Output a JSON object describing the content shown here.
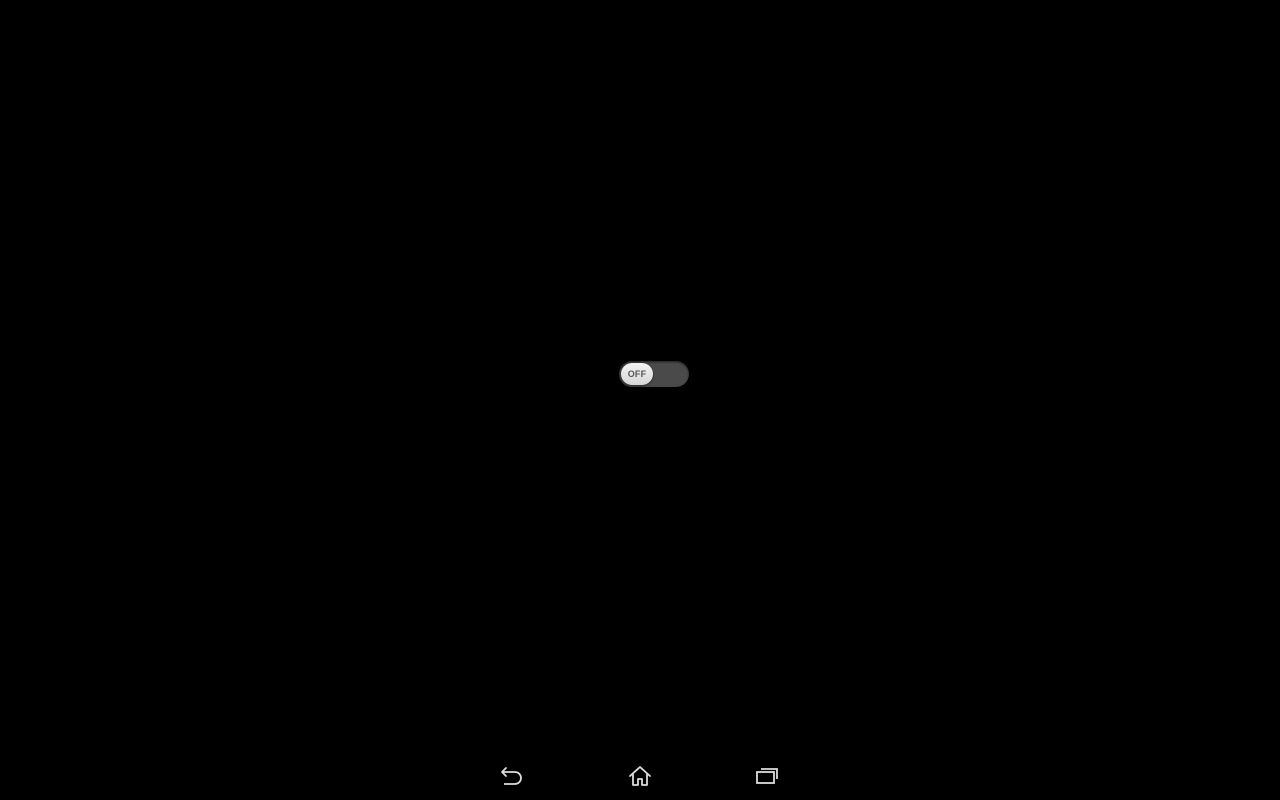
{
  "toggle": {
    "state": "off",
    "label": "OFF"
  },
  "navbar": {
    "icons": [
      "back-icon",
      "home-icon",
      "recents-icon"
    ]
  },
  "colors": {
    "background": "#000000",
    "toggle_track": "#4a4a4a",
    "toggle_thumb": "#e6e6e6",
    "nav_icon": "#dddddd"
  }
}
